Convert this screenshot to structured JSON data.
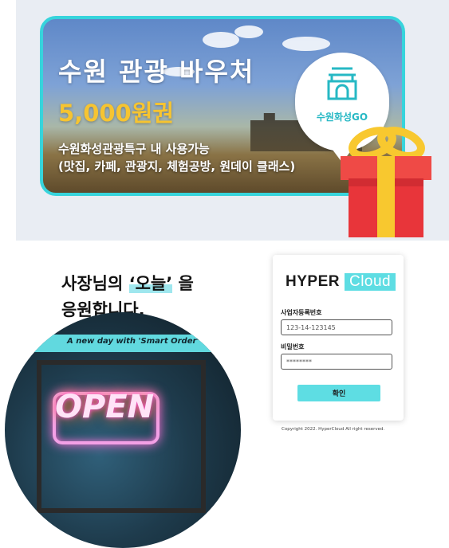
{
  "voucher": {
    "title": "수원 관광 바우처",
    "amount": "5,000원권",
    "desc_line1": "수원화성관광특구 내 사용가능",
    "desc_line2": "(맛집, 카페, 관광지, 체험공방, 원데이 클래스)",
    "badge_label": "수원화성GO"
  },
  "promo": {
    "line1_prefix": "사장님의 ",
    "highlight": "‘오늘’",
    "line1_suffix": " 을",
    "line2": "응원합니다.",
    "tagline": "A new day with 'Smart Order'",
    "sign_text": "OPEN"
  },
  "login": {
    "brand_main": "HYPER",
    "brand_cloud": "Cloud",
    "business_number_label": "사업자등록번호",
    "business_number_value": "123-14-123145",
    "password_label": "비밀번호",
    "password_value": "********",
    "confirm_label": "확인"
  },
  "footer": {
    "copyright": "Copyright 2022. HyperCloud All right reserved."
  },
  "colors": {
    "accent": "#5edde3",
    "voucher_amount": "#f6c431",
    "gift_red": "#e8353a",
    "ribbon_yellow": "#f8c82f"
  }
}
